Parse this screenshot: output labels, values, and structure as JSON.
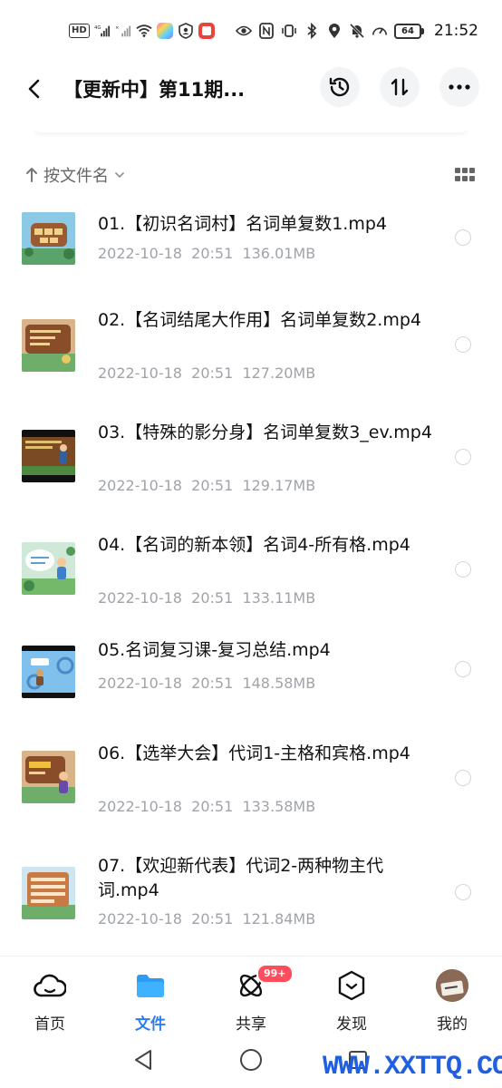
{
  "status_bar": {
    "left_tags": [
      "HD",
      "4G",
      "5G"
    ],
    "time": "21:52",
    "battery": "64"
  },
  "header": {
    "title": "【更新中】第11期...",
    "buttons": [
      "history-icon",
      "sort-transfer-icon",
      "more-icon"
    ]
  },
  "sort": {
    "label": "按文件名"
  },
  "files": [
    {
      "name": "01.【初识名词村】名词单复数1.mp4",
      "date": "2022-10-18",
      "time": "20:51",
      "size": "136.01MB",
      "theme": "#7bb8d8"
    },
    {
      "name": "02.【名词结尾大作用】名词单复数2.mp4",
      "date": "2022-10-18",
      "time": "20:51",
      "size": "127.20MB",
      "theme": "#c89a6a"
    },
    {
      "name": "03.【特殊的影分身】名词单复数3_ev.mp4",
      "date": "2022-10-18",
      "time": "20:51",
      "size": "129.17MB",
      "theme": "#5a3a22"
    },
    {
      "name": "04.【名词的新本领】名词4-所有格.mp4",
      "date": "2022-10-18",
      "time": "20:51",
      "size": "133.11MB",
      "theme": "#a8d6c0"
    },
    {
      "name": "05.名词复习课-复习总结.mp4",
      "date": "2022-10-18",
      "time": "20:51",
      "size": "148.58MB",
      "theme": "#6ab0e0"
    },
    {
      "name": "06.【选举大会】代词1-主格和宾格.mp4",
      "date": "2022-10-18",
      "time": "20:51",
      "size": "133.58MB",
      "theme": "#b0825a"
    },
    {
      "name": "07.【欢迎新代表】代词2-两种物主代词.mp4",
      "date": "2022-10-18",
      "time": "20:51",
      "size": "121.84MB",
      "theme": "#d29a6a"
    }
  ],
  "bottom_nav": [
    {
      "label": "首页",
      "icon": "cloud-icon",
      "active": false
    },
    {
      "label": "文件",
      "icon": "folder-icon",
      "active": true
    },
    {
      "label": "共享",
      "icon": "share-orbit-icon",
      "active": false,
      "badge": "99+"
    },
    {
      "label": "发现",
      "icon": "discover-box-icon",
      "active": false
    },
    {
      "label": "我的",
      "icon": "avatar",
      "active": false
    }
  ],
  "watermark": "WWW.XXTTQ.COM",
  "colors": {
    "accent": "#2d7cf0",
    "badge": "#ff4d5e",
    "meta_text": "#a0a3a8"
  }
}
